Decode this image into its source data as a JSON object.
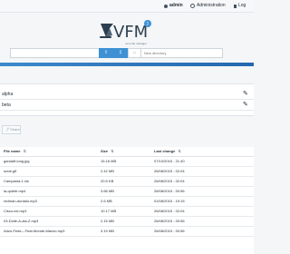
{
  "topbar": {
    "user_label": "admin",
    "admin_label": "Administration",
    "logout_label": "Log"
  },
  "logo": {
    "title": "VFM",
    "tagline": "veno file manager"
  },
  "upload": {
    "new_directory_placeholder": "New directory",
    "progress_fraction": 1
  },
  "folders": [
    {
      "label": "alpha"
    },
    {
      "label": "beta"
    }
  ],
  "share": {
    "label": "Share"
  },
  "table": {
    "columns": [
      "File name",
      "Size",
      "Last change"
    ],
    "rows": [
      {
        "name": "gandalf-long.jpg",
        "size": "15.16 MB",
        "date": "07/10/2015 - 21:40"
      },
      {
        "name": "scrat.gif",
        "size": "2.42 MB",
        "date": "26/08/2015 - 02:04"
      },
      {
        "name": "Campania-1.xls",
        "size": "20.5 KB",
        "date": "26/08/2015 - 02:04"
      },
      {
        "name": "la-quiete.mp4",
        "size": "3.66 MB",
        "date": "26/08/2015 - 00:56"
      },
      {
        "name": "redman-duntalo.mp3",
        "size": "2.6 MB",
        "date": "01/08/2015 - 19:15"
      },
      {
        "name": "Cisco-exi.mp3",
        "size": "10.17 MB",
        "date": "26/08/2015 - 02:04"
      },
      {
        "name": "03-Dolle-A-ala-Z.mp3",
        "size": "2.15 MB",
        "date": "26/08/2015 - 00:56"
      },
      {
        "name": "Adzo-Fede---Feat-Monde-Marcio.mp3",
        "size": "3.19 MB",
        "date": "26/08/2015 - 00:56"
      }
    ]
  },
  "icons": {
    "user": "user-icon",
    "administration": "gear-icon",
    "logout": "logout-icon",
    "upload": "upload-icon",
    "download": "download-icon",
    "new_folder": "folder-icon",
    "edit": "edit-icon",
    "share": "share-icon",
    "sort": "sort-icon"
  },
  "colors": {
    "accent": "#3f91d4",
    "progress": "#2468ae",
    "background": "#f4f6f8"
  }
}
